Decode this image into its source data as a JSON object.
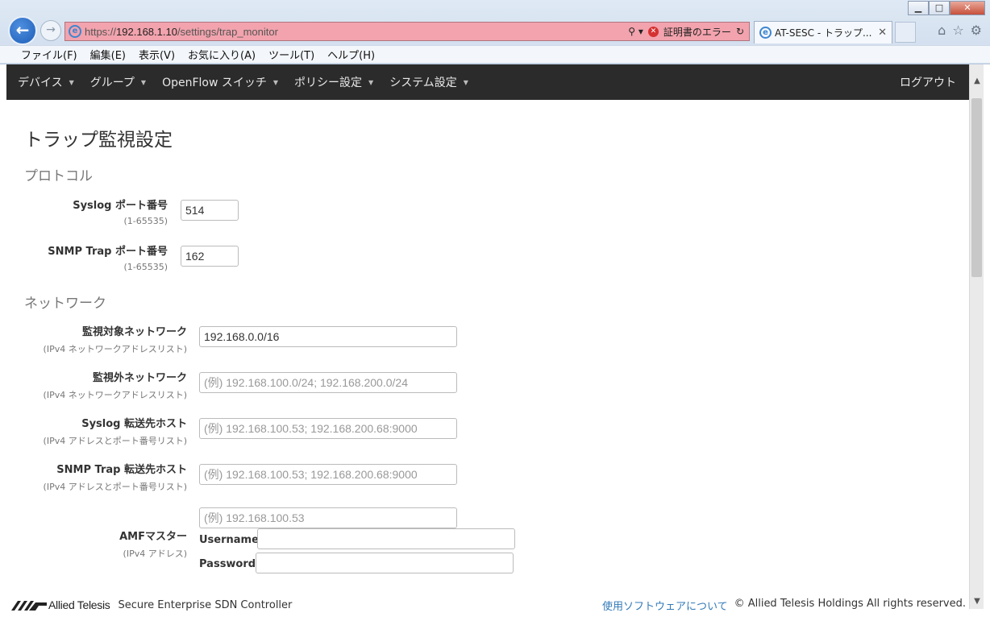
{
  "browser": {
    "url_prefix": "https://",
    "url_host": "192.168.1.10",
    "url_path": "/settings/trap_monitor",
    "cert_error": "証明書のエラー",
    "tab_title": "AT-SESC - トラップ...",
    "menu": [
      "ファイル(F)",
      "編集(E)",
      "表示(V)",
      "お気に入り(A)",
      "ツール(T)",
      "ヘルプ(H)"
    ]
  },
  "navbar": {
    "items": [
      "デバイス",
      "グループ",
      "OpenFlow スイッチ",
      "ポリシー設定",
      "システム設定"
    ],
    "logout": "ログアウト"
  },
  "page": {
    "title": "トラップ監視設定",
    "protocol_section": "プロトコル",
    "network_section": "ネットワーク",
    "syslog_port": {
      "label": "Syslog ポート番号",
      "hint": "(1-65535)",
      "value": "514"
    },
    "snmp_port": {
      "label": "SNMP Trap ポート番号",
      "hint": "(1-65535)",
      "value": "162"
    },
    "monitored_network": {
      "label": "監視対象ネットワーク",
      "hint": "(IPv4 ネットワークアドレスリスト)",
      "value": "192.168.0.0/16"
    },
    "excluded_network": {
      "label": "監視外ネットワーク",
      "hint": "(IPv4 ネットワークアドレスリスト)",
      "placeholder": "(例) 192.168.100.0/24; 192.168.200.0/24"
    },
    "syslog_forward": {
      "label": "Syslog 転送先ホスト",
      "hint": "(IPv4 アドレスとポート番号リスト)",
      "placeholder": "(例) 192.168.100.53; 192.168.200.68:9000"
    },
    "snmp_forward": {
      "label": "SNMP Trap 転送先ホスト",
      "hint": "(IPv4 アドレスとポート番号リスト)",
      "placeholder": "(例) 192.168.100.53; 192.168.200.68:9000"
    },
    "amf_master": {
      "label": "AMFマスター",
      "hint": "(IPv4 アドレス)",
      "placeholder": "(例) 192.168.100.53",
      "username_label": "Username",
      "password_label": "Password"
    }
  },
  "footer": {
    "brand": "Allied Telesis",
    "product": "Secure Enterprise SDN Controller",
    "software_link": "使用ソフトウェアについて",
    "copyright": "© Allied Telesis Holdings All rights reserved."
  },
  "colors": {
    "navbar": "#2b2b2b",
    "link": "#337ab7",
    "address_bar_error": "#f2a3ad"
  }
}
